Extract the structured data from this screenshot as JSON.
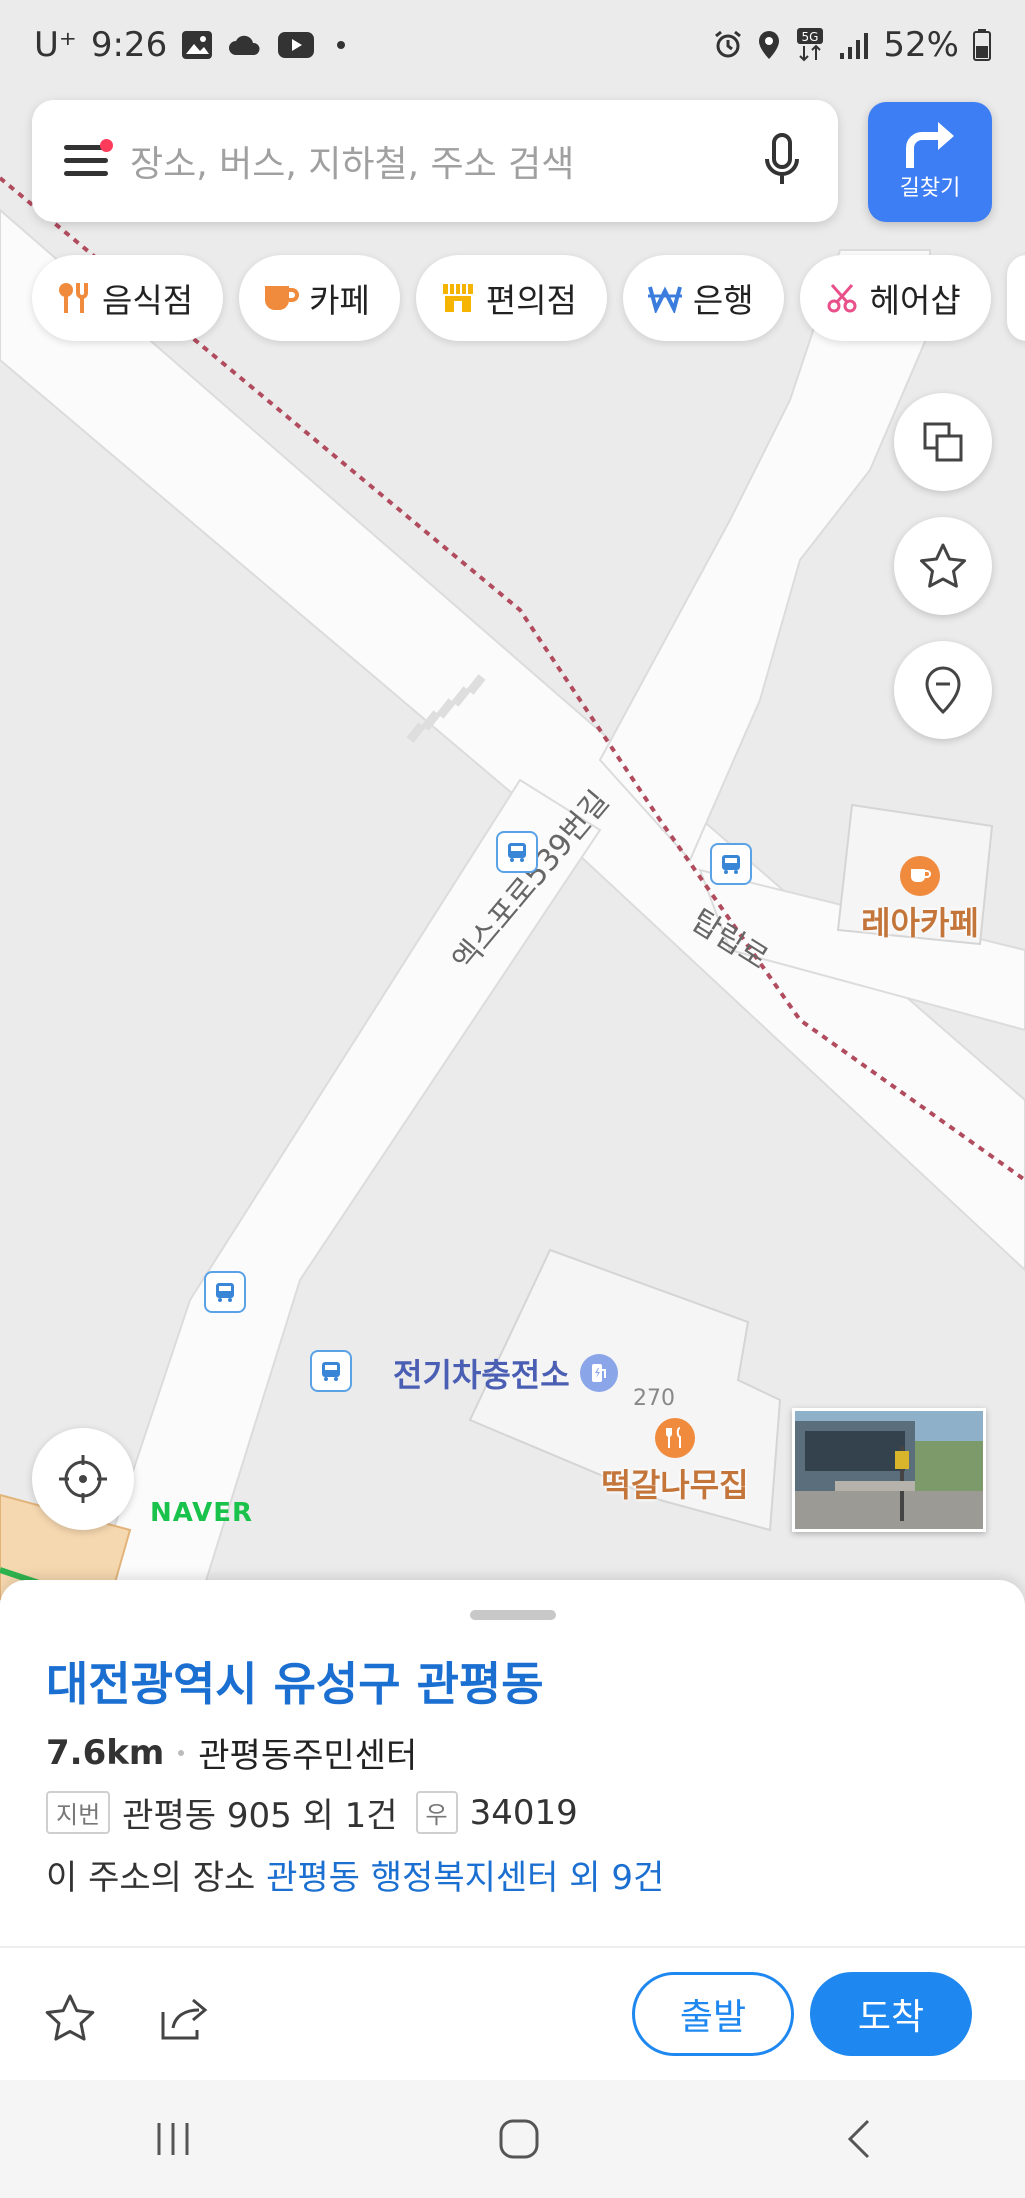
{
  "status_bar": {
    "carrier": "U⁺",
    "time": "9:26",
    "battery": "52%"
  },
  "search": {
    "placeholder": "장소, 버스, 지하철, 주소 검색",
    "directions_label": "길찾기"
  },
  "categories": [
    {
      "label": "음식점",
      "icon": "fork-knife-icon",
      "color": "#f08a3c"
    },
    {
      "label": "카페",
      "icon": "coffee-cup-icon",
      "color": "#f08a3c"
    },
    {
      "label": "편의점",
      "icon": "store-icon",
      "color": "#f5b400"
    },
    {
      "label": "은행",
      "icon": "won-icon",
      "color": "#3b7ddd"
    },
    {
      "label": "헤어샵",
      "icon": "scissors-icon",
      "color": "#e9508a"
    }
  ],
  "map": {
    "road_labels": [
      "엑스포로539번길",
      "탑립로"
    ],
    "pois": {
      "cafe": "레아카페",
      "ev_station": "전기차충전소",
      "building_number": "270",
      "restaurant": "떡갈나무집"
    },
    "brand": "NAVER"
  },
  "place": {
    "title": "대전광역시 유성구 관평동",
    "distance": "7.6km",
    "landmark": "관평동주민센터",
    "lot_tag": "지번",
    "lot_address": "관평동 905 외 1건",
    "postal_tag": "우",
    "postal_code": "34019",
    "places_prefix": "이 주소의 장소",
    "places_link": "관평동 행정복지센터 외 9건"
  },
  "actions": {
    "depart": "출발",
    "arrive": "도착"
  },
  "colors": {
    "accent": "#1a6fd1",
    "directions_button": "#3e7ef5",
    "arrive_button": "#1e88f0"
  }
}
